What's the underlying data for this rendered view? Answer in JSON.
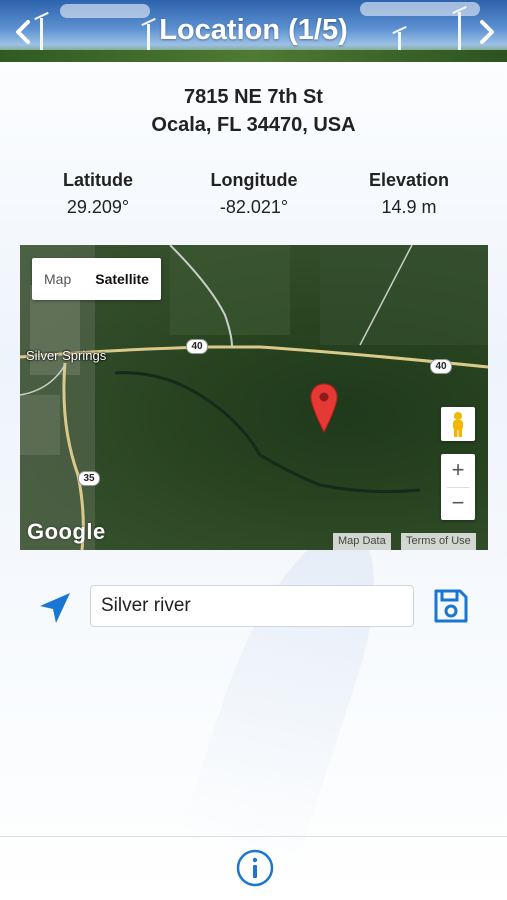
{
  "header": {
    "title": "Location (1/5)",
    "prev_icon": "chevron-left-icon",
    "next_icon": "chevron-right-icon"
  },
  "address": {
    "line1": "7815 NE 7th St",
    "line2": "Ocala, FL 34470, USA"
  },
  "coordinates": {
    "latitude_label": "Latitude",
    "latitude_value": "29.209°",
    "longitude_label": "Longitude",
    "longitude_value": "-82.021°",
    "elevation_label": "Elevation",
    "elevation_value": "14.9 m"
  },
  "map": {
    "map_type_options": [
      "Map",
      "Satellite"
    ],
    "selected_type": "Satellite",
    "place_label": "Silver Springs",
    "route_40": "40",
    "route_40b": "40",
    "route_35": "35",
    "zoom_in": "+",
    "zoom_out": "−",
    "logo": "Google",
    "map_data_link": "Map Data",
    "terms_link": "Terms of Use",
    "marker_color": "#e53935"
  },
  "form": {
    "name_value": "Silver river",
    "locate_icon": "navigation-arrow-icon",
    "save_icon": "floppy-disk-icon"
  },
  "footer": {
    "info_icon": "info-circle-icon"
  },
  "colors": {
    "accent": "#1976d2",
    "header_sky": "#2d63ad"
  }
}
